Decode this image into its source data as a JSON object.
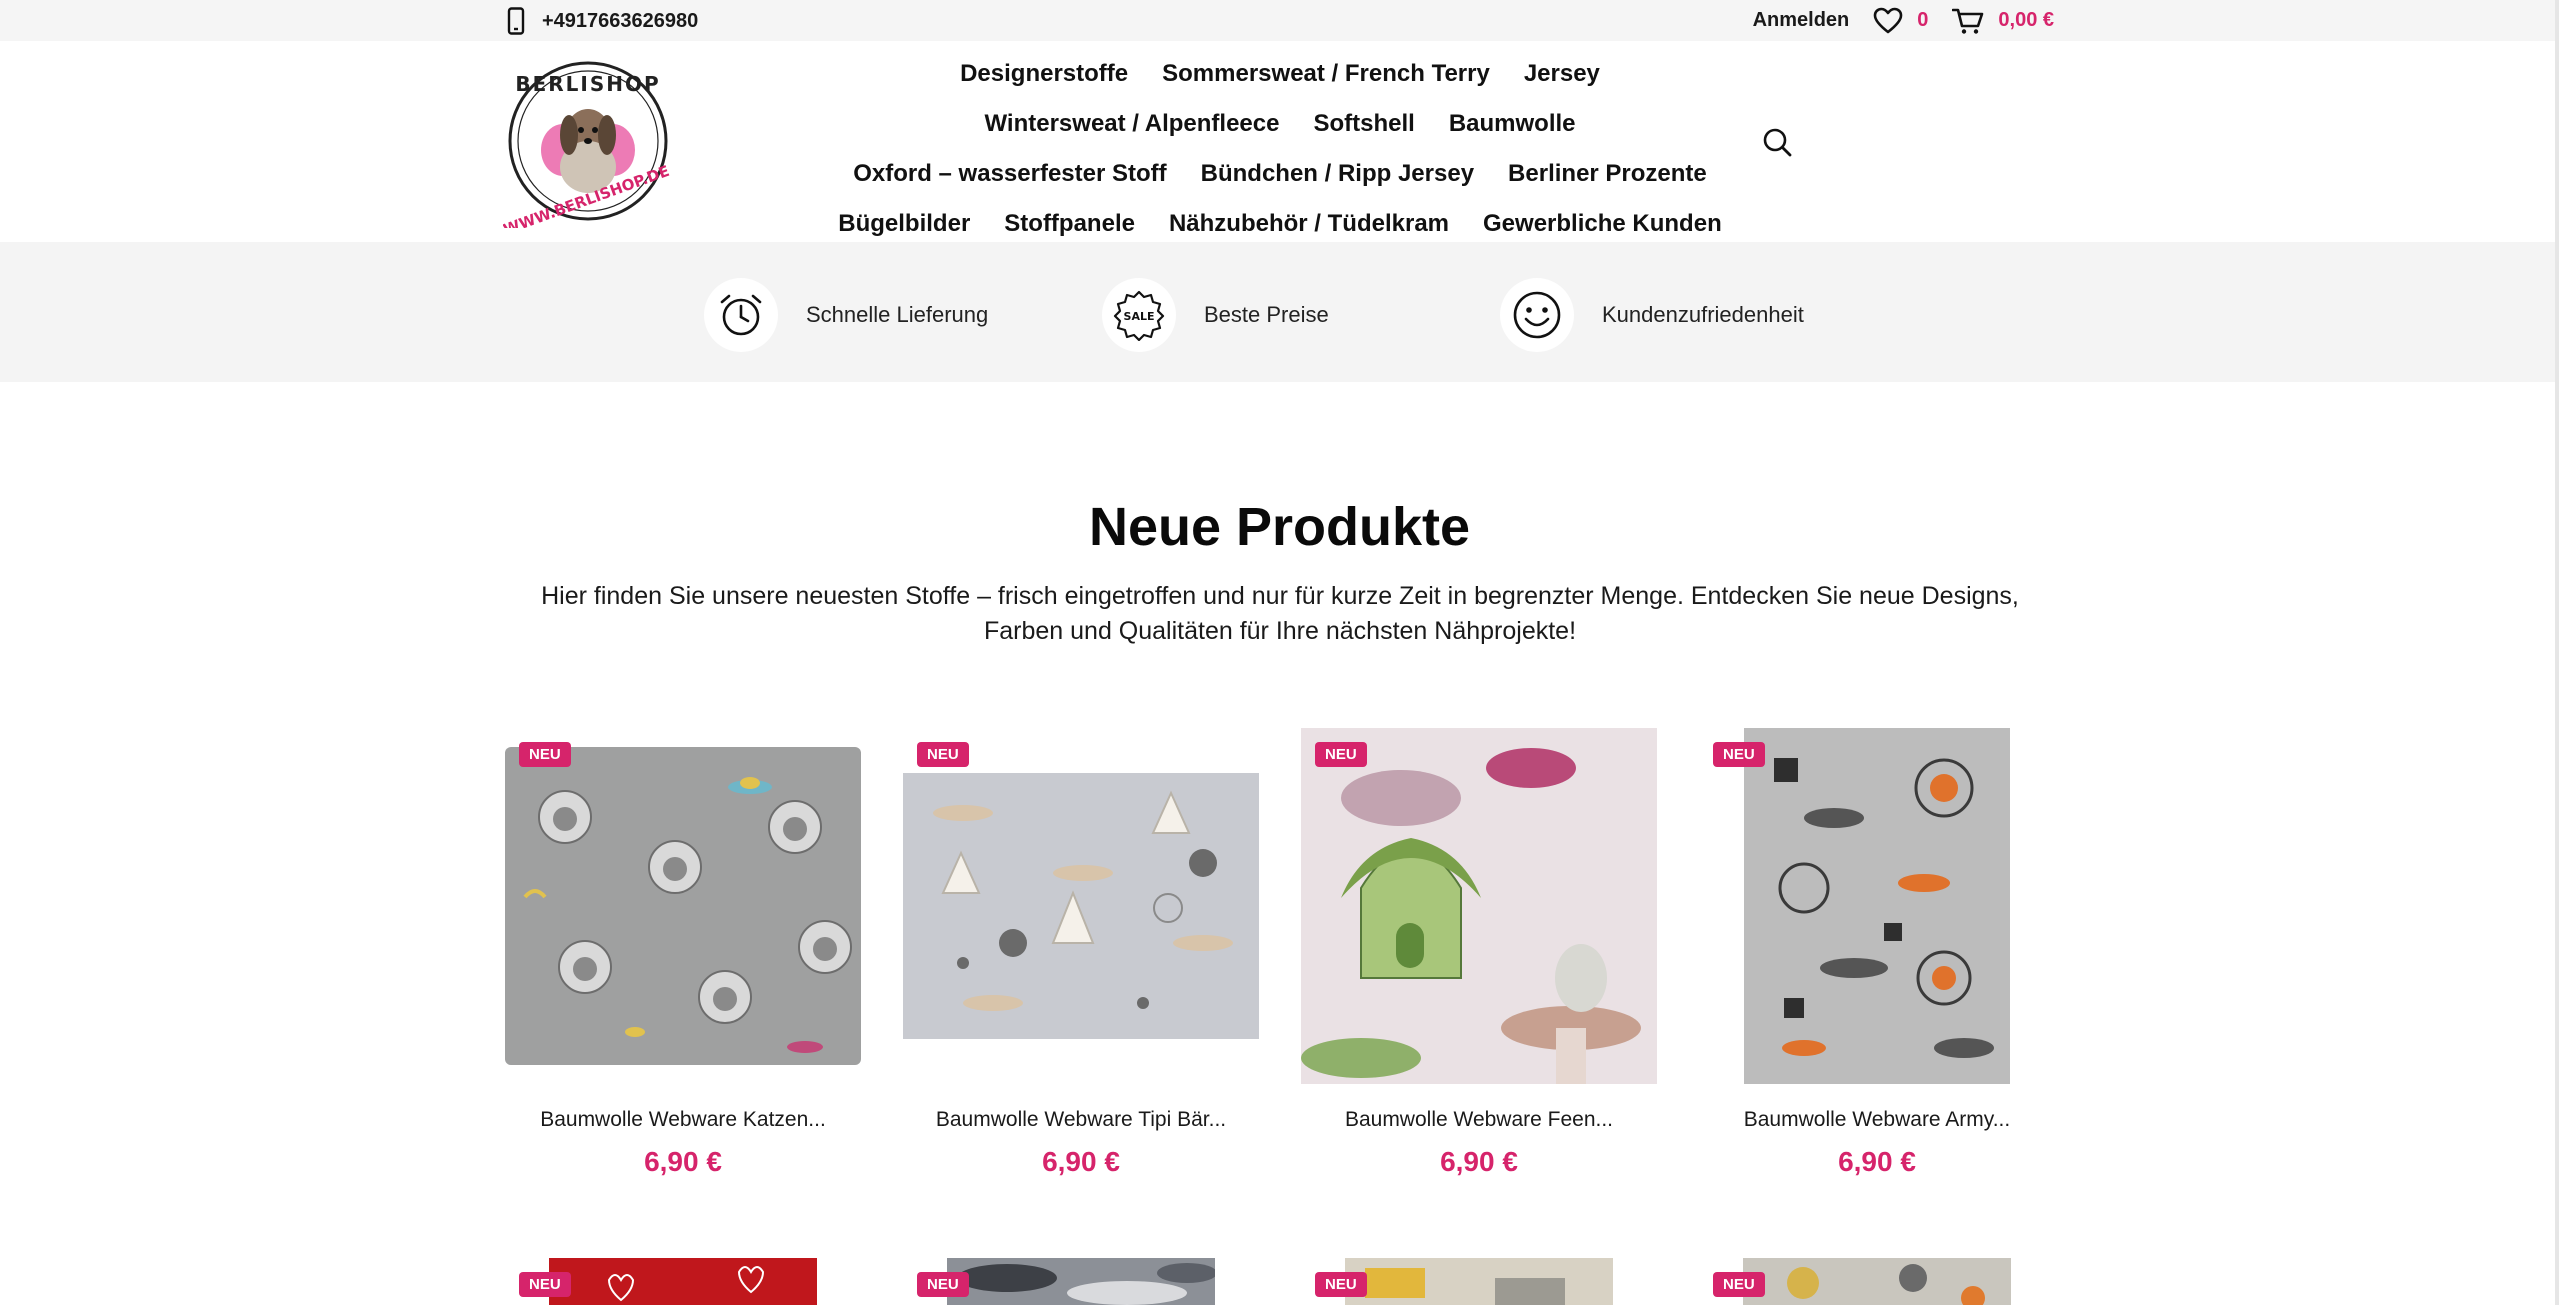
{
  "topbar": {
    "phone": "+4917663626980",
    "login": "Anmelden",
    "wishlist_count": "0",
    "cart_total": "0,00 €"
  },
  "logo": {
    "alt": "BERLISHOP",
    "url_text": "WWW.BERLISHOP.DE"
  },
  "nav": {
    "items": [
      "Designerstoffe",
      "Sommersweat / French Terry",
      "Jersey",
      "Wintersweat / Alpenfleece",
      "Softshell",
      "Baumwolle",
      "Oxford – wasserfester Stoff",
      "Bündchen / Ripp Jersey",
      "Berliner Prozente",
      "Bügelbilder",
      "Stoffpanele",
      "Nähzubehör / Tüdelkram",
      "Gewerbliche Kunden"
    ]
  },
  "benefits": [
    {
      "label": "Schnelle Lieferung",
      "icon": "alarm-clock-icon"
    },
    {
      "label": "Beste Preise",
      "icon": "sale-badge-icon",
      "icon_text": "SALE"
    },
    {
      "label": "Kundenzufriedenheit",
      "icon": "smiley-icon"
    }
  ],
  "section": {
    "title": "Neue Produkte",
    "description": "Hier finden Sie unsere neuesten Stoffe – frisch eingetroffen und nur für kurze Zeit in begrenzter Menge. Entdecken Sie neue Designs, Farben und Qualitäten für Ihre nächsten Nähprojekte!"
  },
  "products": [
    {
      "badge": "NEU",
      "name": "Baumwolle Webware Katzen...",
      "price": "6,90 €"
    },
    {
      "badge": "NEU",
      "name": "Baumwolle Webware Tipi Bär...",
      "price": "6,90 €"
    },
    {
      "badge": "NEU",
      "name": "Baumwolle Webware Feen...",
      "price": "6,90 €"
    },
    {
      "badge": "NEU",
      "name": "Baumwolle Webware Army...",
      "price": "6,90 €"
    }
  ],
  "products_row2": [
    {
      "badge": "NEU"
    },
    {
      "badge": "NEU"
    },
    {
      "badge": "NEU"
    },
    {
      "badge": "NEU"
    }
  ],
  "colors": {
    "accent": "#d6246b",
    "strip": "#f4f4f4"
  }
}
